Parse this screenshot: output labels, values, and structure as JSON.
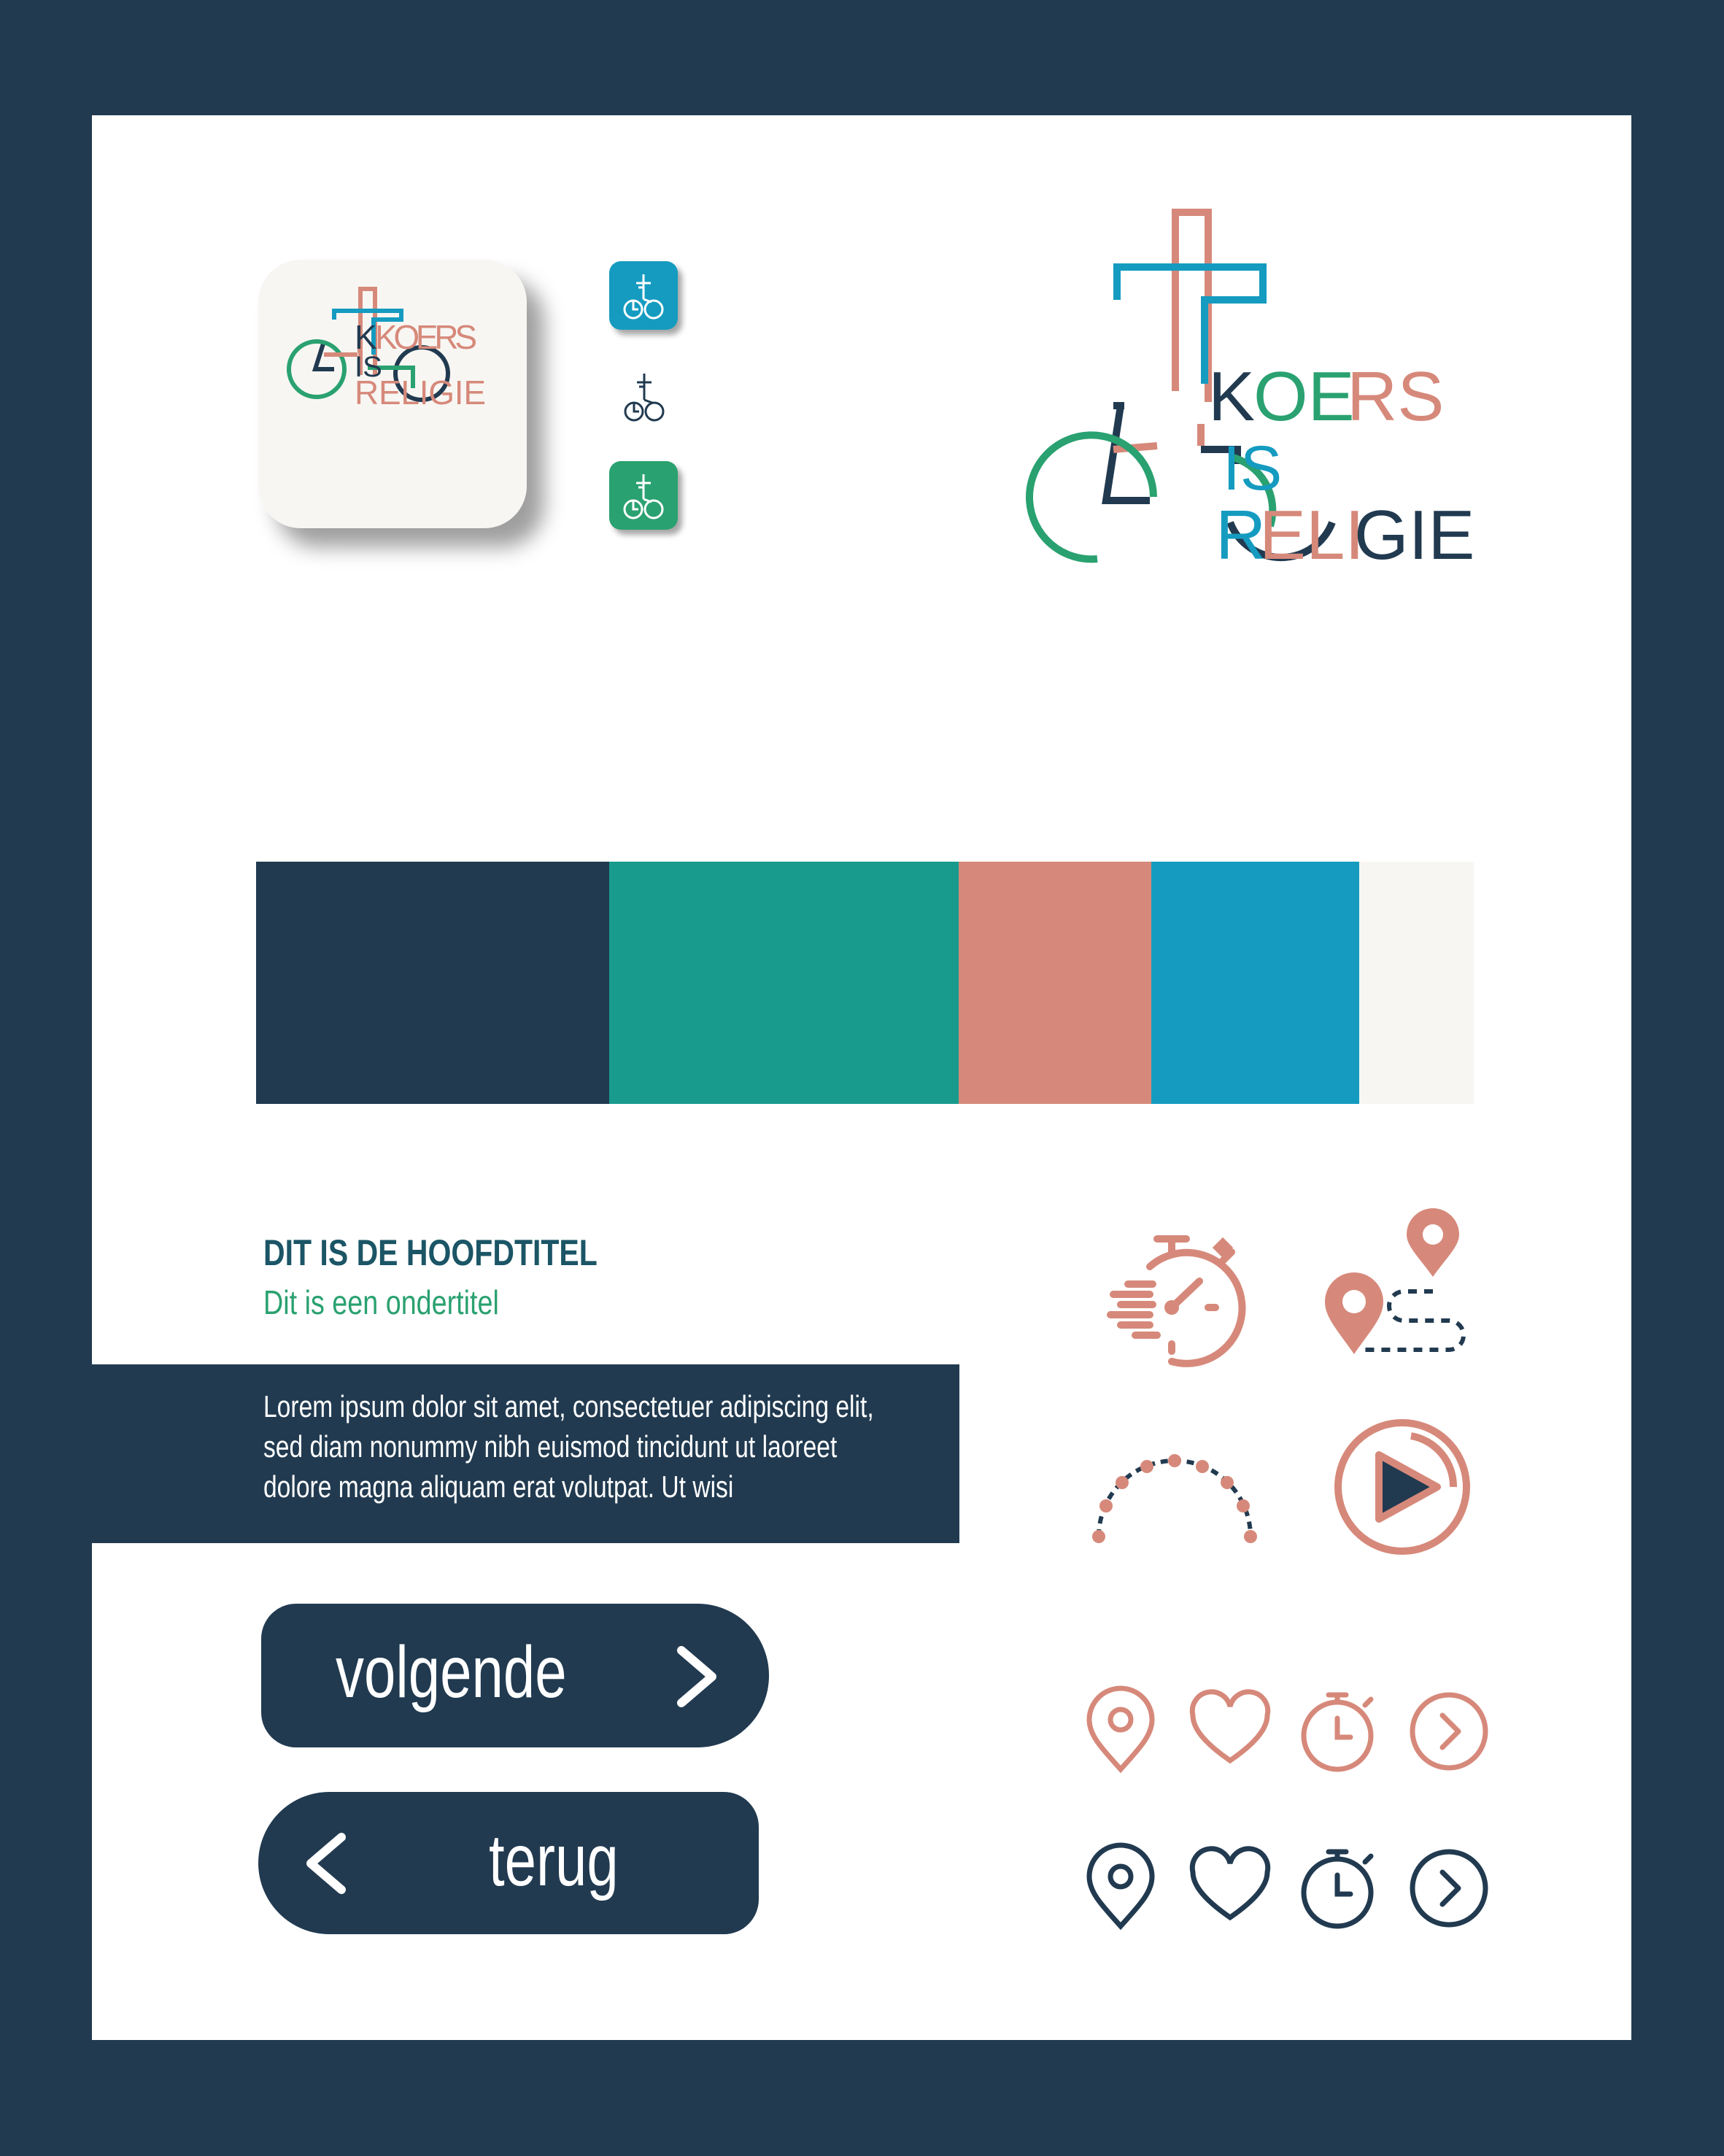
{
  "colors": {
    "navy": "#213a50",
    "teal": "#189b8c",
    "salmon": "#d6897a",
    "blue": "#159bc0",
    "offwhite": "#f8f6f3",
    "green": "#2aa170",
    "darkteal": "#1b5566"
  },
  "logo": {
    "line1": "KOERS",
    "line2": "IS",
    "line3": "RELIGIE"
  },
  "palette": [
    {
      "name": "navy",
      "hex": "#213a50"
    },
    {
      "name": "teal",
      "hex": "#189b8c"
    },
    {
      "name": "salmon",
      "hex": "#d6897a"
    },
    {
      "name": "blue",
      "hex": "#159bc0"
    },
    {
      "name": "offwhite",
      "hex": "#f8f6f3"
    }
  ],
  "typography": {
    "title": "DIT IS DE HOOFDTITEL",
    "subtitle": "Dit is een ondertitel",
    "body_lines": [
      "Lorem ipsum dolor sit amet, consectetuer adipiscing elit,",
      "sed diam nonummy nibh euismod tincidunt ut laoreet",
      "dolore magna aliquam erat volutpat. Ut wisi"
    ]
  },
  "buttons": {
    "next_label": "volgende",
    "back_label": "terug"
  },
  "icons": {
    "large": [
      "stopwatch-speed-icon",
      "route-icon",
      "progress-arc-icon",
      "play-icon"
    ],
    "small_row_salmon": [
      "location-pin-icon",
      "heart-icon",
      "timer-icon",
      "chevron-right-circle-icon"
    ],
    "small_row_navy": [
      "location-pin-icon",
      "heart-icon",
      "timer-icon",
      "chevron-right-circle-icon"
    ]
  }
}
